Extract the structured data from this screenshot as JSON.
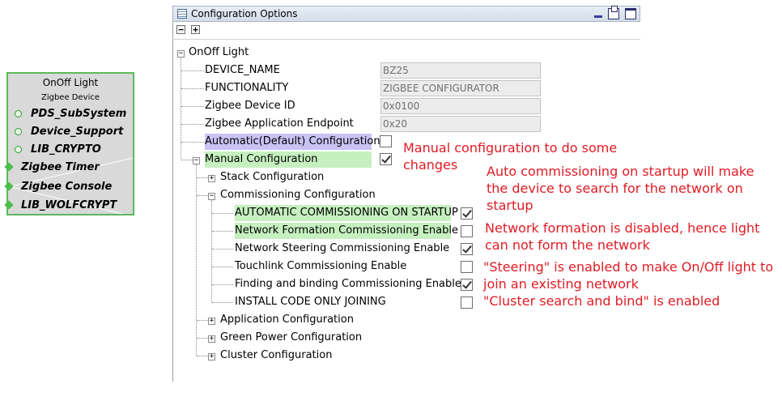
{
  "component": {
    "title": "OnOff Light",
    "subtitle": "Zigbee Device",
    "dependencies": [
      "PDS_SubSystem",
      "Device_Support",
      "LIB_CRYPTO"
    ],
    "connections": [
      "Zigbee Timer",
      "Zigbee Console",
      "LIB_WOLFCRYPT"
    ]
  },
  "window": {
    "title": "Configuration Options",
    "collapse_all": "−",
    "expand_all": "+"
  },
  "tree": {
    "root": "OnOff Light",
    "device_name_label": "DEVICE_NAME",
    "device_name_value": "BZ25",
    "functionality_label": "FUNCTIONALITY",
    "functionality_value": "ZIGBEE CONFIGURATOR",
    "device_id_label": "Zigbee Device ID",
    "device_id_value": "0x0100",
    "endpoint_label": "Zigbee Application Endpoint",
    "endpoint_value": "0x20",
    "auto_config_label": "Automatic(Default) Configuration",
    "auto_config_checked": false,
    "manual_config_label": "Manual Configuration",
    "manual_config_checked": true,
    "stack_config": "Stack Configuration",
    "commissioning_config": "Commissioning Configuration",
    "commissioning_items": [
      {
        "label": "AUTOMATIC COMMISSIONING ON STARTUP",
        "checked": true
      },
      {
        "label": "Network Formation Commissioning Enable",
        "checked": false
      },
      {
        "label": "Network Steering Commissioning Enable",
        "checked": true
      },
      {
        "label": "Touchlink Commissioning Enable",
        "checked": false
      },
      {
        "label": "Finding and binding Commissioning Enable",
        "checked": true
      },
      {
        "label": "INSTALL CODE ONLY JOINING",
        "checked": false
      }
    ],
    "application_config": "Application Configuration",
    "green_power_config": "Green Power Configuration",
    "cluster_config": "Cluster Configuration"
  },
  "annotations": {
    "manual_1": "Manual configuration to do some",
    "manual_2": "changes",
    "auto_1": "Auto commissioning on startup will make",
    "auto_2": "the device to search for the network on",
    "auto_3": "startup",
    "formation_1": "Network formation is disabled, hence light",
    "formation_2": "can not form the network",
    "steering_1": "\"Steering\" is enabled to make On/Off light to",
    "steering_2": "join an existing network",
    "cluster": "\"Cluster search and bind\" is enabled"
  },
  "colors": {
    "annotation": "#e01b24",
    "highlight_green": "#c6f0c0",
    "highlight_blue": "#c9c3f4",
    "component_border": "#5cb85c"
  }
}
